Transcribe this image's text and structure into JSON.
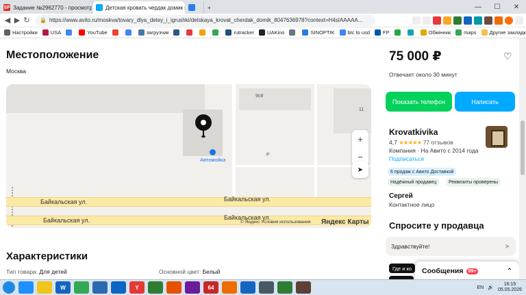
{
  "browser": {
    "tabs": [
      {
        "title": "Задание №2962770 - просмотр з",
        "icon": "SP",
        "color": "#d93025"
      },
      {
        "title": "Детская кровать чердак домик к",
        "icon": "",
        "color": "#00aaff",
        "active": true
      },
      {
        "title": "",
        "icon": "",
        "color": "#2b7de9"
      }
    ],
    "new_tab": "+",
    "window": {
      "minimize": "—",
      "maximize": "☐",
      "close": "✕"
    },
    "url": "https://www.avito.ru/moskva/tovary_dlya_detey_i_igrushki/detskaya_krovat_cherdak_domik_8047636978?context=H4sIAAAAA...",
    "bookmarks": [
      {
        "label": "Настройки",
        "color": "#5f6368"
      },
      {
        "label": "USA",
        "color": "#b31942"
      },
      {
        "label": "",
        "color": "#4285f4"
      },
      {
        "label": "YouTube",
        "color": "#ff0000"
      },
      {
        "label": "",
        "color": "#ea4335"
      },
      {
        "label": "",
        "color": "#4285f4"
      },
      {
        "label": "загрузчик",
        "color": "#4a76a8"
      },
      {
        "label": "",
        "color": "#2a5885"
      },
      {
        "label": "",
        "color": "#e63946"
      },
      {
        "label": "",
        "color": "#f0a30a"
      },
      {
        "label": "",
        "color": "#34a853"
      },
      {
        "label": "rutracker",
        "color": "#1f4e79"
      },
      {
        "label": "UAKino",
        "color": "#222222"
      },
      {
        "label": "",
        "color": "#6c757d"
      },
      {
        "label": "SINOPTIK",
        "color": "#2c7be5"
      },
      {
        "label": "btc to usd",
        "color": "#4285f4"
      },
      {
        "label": "FP",
        "color": "#0056b3"
      },
      {
        "label": "",
        "color": "#28a745"
      },
      {
        "label": "",
        "color": "#17a2b8"
      },
      {
        "label": "Обмінник",
        "color": "#e0a800"
      },
      {
        "label": "maps",
        "color": "#34a853"
      },
      {
        "label": "Другие закладки",
        "color": "#f2c14e"
      }
    ]
  },
  "location": {
    "title": "Местоположение",
    "city": "Москва",
    "map": {
      "street1": "Байкальская ул.",
      "street2": "Байкальская ул.",
      "street3": "Байкальская ул.",
      "street4": "Байкальская ул.",
      "label_9c8": "9с8",
      "label_11": "11",
      "label_p": "P",
      "poi": "Автомойка",
      "zoom_in": "+",
      "zoom_out": "−",
      "geo": "➤",
      "copyright": "© Яндекс Условия использования",
      "logo": "Яндекс Карты"
    }
  },
  "characteristics": {
    "title": "Характеристики",
    "items": [
      {
        "label": "Тип товара:",
        "value": "Для детей"
      },
      {
        "label": "Основной цвет:",
        "value": "Белый"
      }
    ]
  },
  "sidebar": {
    "price": "75 000 ₽",
    "reply_time": "Отвечает около 30 минут",
    "show_phone": "Показать телефон",
    "write": "Написать",
    "seller_name": "Krovatkivika",
    "rating": "4,7",
    "stars": "★★★★★",
    "reviews": "77 отзывов",
    "company": "Компания · На Авито с 2014 года",
    "subscribe": "Подписаться",
    "badges": [
      "6 продаж с Авито Доставкой",
      "Надёжный продавец",
      "Реквизиты проверены"
    ],
    "contact_name": "Сергей",
    "contact_role": "Контактное лицо",
    "ask_title": "Спросите у продавца",
    "ask_placeholder": "Здравствуйте!",
    "ask_chip1": "Где и ко",
    "messages": "Сообщения",
    "messages_count": "99+"
  },
  "taskbar": {
    "lang": "EN",
    "time": "16:15",
    "date": "05.05.2026",
    "apps": [
      {
        "label": "",
        "color": "#1e90ff"
      },
      {
        "label": "",
        "color": "#f0c419"
      },
      {
        "label": "W",
        "color": "#1565c0"
      },
      {
        "label": "",
        "color": "#34a853"
      },
      {
        "label": "",
        "color": "#2a6ab3"
      },
      {
        "label": "",
        "color": "#0a66c2"
      },
      {
        "label": "Y",
        "color": "#e53935"
      },
      {
        "label": "",
        "color": "#2e7d32"
      },
      {
        "label": "",
        "color": "#e65100"
      },
      {
        "label": "",
        "color": "#6a1b9a"
      },
      {
        "label": "64",
        "color": "#c62828"
      },
      {
        "label": "",
        "color": "#ef6c00"
      },
      {
        "label": "",
        "color": "#1565c0"
      },
      {
        "label": "",
        "color": "#455a64"
      },
      {
        "label": "",
        "color": "#2e7d32"
      },
      {
        "label": "",
        "color": "#5d4037"
      }
    ]
  }
}
